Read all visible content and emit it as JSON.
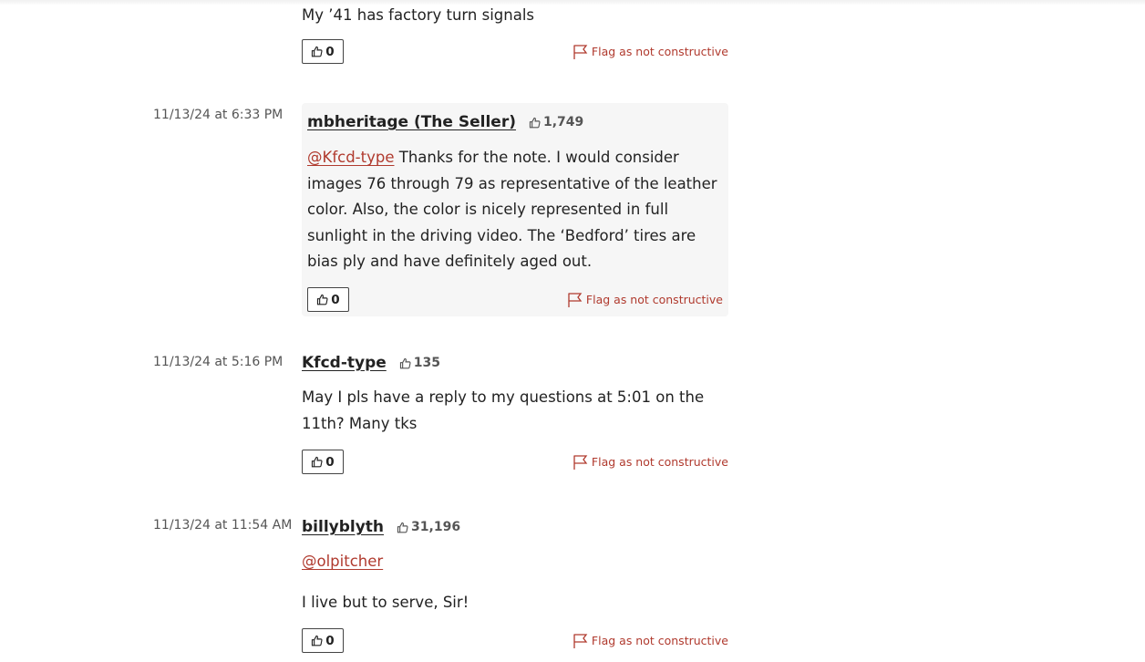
{
  "comments": [
    {
      "body": "My ’41 has factory turn signals",
      "votes": "0",
      "flag_label": "Flag as not constructive"
    },
    {
      "timestamp": "11/13/24 at 6:33 PM",
      "author": "mbheritage (The Seller)",
      "reputation": "1,749",
      "mention": "@Kfcd-type",
      "body": " Thanks for the note. I would consider images 76 through 79 as representative of the leather color. Also, the color is nicely represented in full sunlight in the driving video. The ‘Bedford’ tires are bias ply and have definitely aged out.",
      "votes": "0",
      "flag_label": "Flag as not constructive"
    },
    {
      "timestamp": "11/13/24 at 5:16 PM",
      "author": "Kfcd-type",
      "reputation": "135",
      "body": "May I pls have a reply to my questions at 5:01 on the 11th? Many tks",
      "votes": "0",
      "flag_label": "Flag as not constructive"
    },
    {
      "timestamp": "11/13/24 at 11:54 AM",
      "author": "billyblyth",
      "reputation": "31,196",
      "mention": "@olpitcher",
      "body": "I live but to serve, Sir!",
      "votes": "0",
      "flag_label": "Flag as not constructive"
    }
  ],
  "icons": {
    "vote": "thumbs-up-icon",
    "reputation": "thumbs-up-icon",
    "flag": "flag-icon"
  },
  "colors": {
    "accent": "#b03a2e",
    "seller_bg": "#f6f6f6"
  }
}
